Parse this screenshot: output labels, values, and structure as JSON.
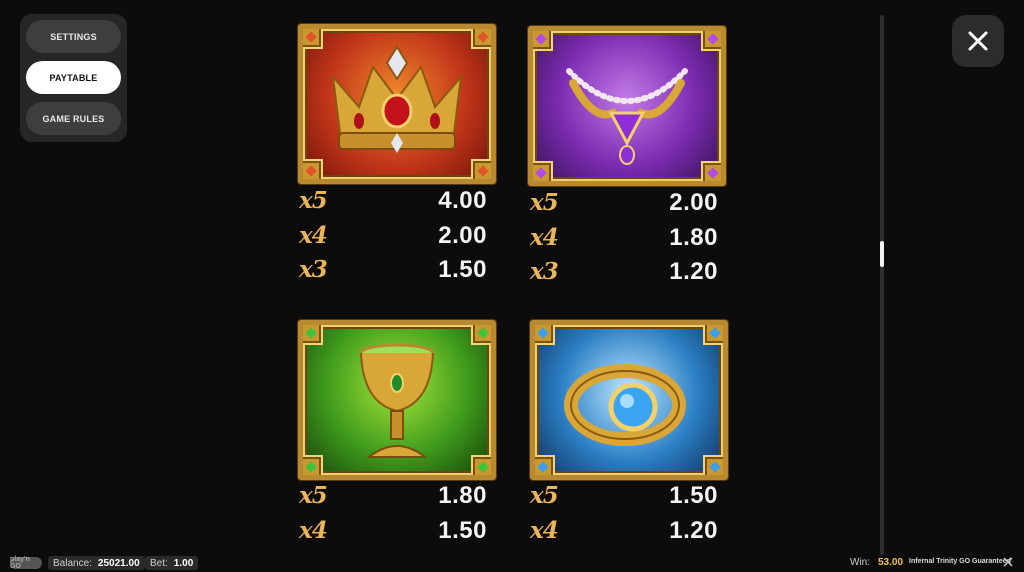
{
  "menu": {
    "settings": "SETTINGS",
    "paytable": "PAYTABLE",
    "game_rules": "GAME RULES"
  },
  "paytable": {
    "symbols": [
      {
        "name": "crown",
        "color": "#c2361a",
        "rows": [
          {
            "mult": "x5",
            "value": "4.00"
          },
          {
            "mult": "x4",
            "value": "2.00"
          },
          {
            "mult": "x3",
            "value": "1.50"
          }
        ]
      },
      {
        "name": "necklace",
        "color": "#7a2bb0",
        "rows": [
          {
            "mult": "x5",
            "value": "2.00"
          },
          {
            "mult": "x4",
            "value": "1.80"
          },
          {
            "mult": "x3",
            "value": "1.20"
          }
        ]
      },
      {
        "name": "chalice",
        "color": "#3f9a1c",
        "rows": [
          {
            "mult": "x5",
            "value": "1.80"
          },
          {
            "mult": "x4",
            "value": "1.50"
          }
        ]
      },
      {
        "name": "ring",
        "color": "#2b7fc4",
        "rows": [
          {
            "mult": "x5",
            "value": "1.50"
          },
          {
            "mult": "x4",
            "value": "1.20"
          }
        ]
      }
    ]
  },
  "status_bar": {
    "logo": "play'n GO",
    "balance_label": "Balance:",
    "balance_value": "25021.00",
    "bet_label": "Bet:",
    "bet_value": "1.00",
    "win_label": "Win:",
    "win_value": "53.00",
    "game_name": "Infernal Trinity GO Guaranteed"
  },
  "colors": {
    "multiplier_text": "#e9b45a",
    "value_text": "#f4f4f4",
    "frame_gold": "#b8892e",
    "win_value": "#f2c14e"
  }
}
